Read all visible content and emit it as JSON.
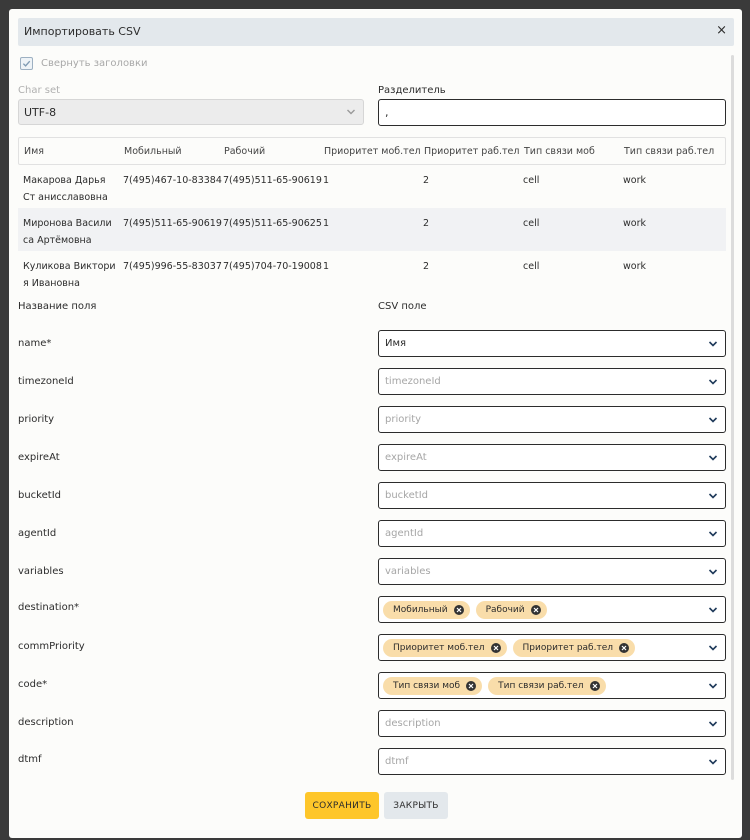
{
  "dialog": {
    "title": "Импортировать CSV",
    "close_glyph": "×"
  },
  "options": {
    "collapse_headers_label": "Свернуть заголовки",
    "collapse_headers_checked": true,
    "charset_label": "Char set",
    "charset_value": "UTF-8",
    "separator_label": "Разделитель",
    "separator_value": ","
  },
  "preview": {
    "columns": [
      "Имя",
      "Мобильный",
      "Рабочий",
      "Приоритет моб.тел",
      "Приоритет раб.тел",
      "Тип связи моб",
      "Тип связи раб.тел"
    ],
    "rows": [
      [
        "Макарова Дарья Ст анисславовна",
        "7(495)467-10-83384",
        "7(495)511-65-90619",
        "1",
        "2",
        "cell",
        "work"
      ],
      [
        "Миронова Васили са Артёмовна",
        "7(495)511-65-90619",
        "7(495)511-65-90625",
        "1",
        "2",
        "cell",
        "work"
      ],
      [
        "Куликова Виктори я Ивановна",
        "7(495)996-55-83037",
        "7(495)704-70-19008",
        "1",
        "2",
        "cell",
        "work"
      ]
    ]
  },
  "mapping": {
    "field_header": "Название поля",
    "csv_header": "CSV поле",
    "fields": [
      {
        "name": "name*",
        "value": "Имя",
        "placeholder": ""
      },
      {
        "name": "timezoneId",
        "value": "",
        "placeholder": "timezoneId"
      },
      {
        "name": "priority",
        "value": "",
        "placeholder": "priority"
      },
      {
        "name": "expireAt",
        "value": "",
        "placeholder": "expireAt"
      },
      {
        "name": "bucketId",
        "value": "",
        "placeholder": "bucketId"
      },
      {
        "name": "agentId",
        "value": "",
        "placeholder": "agentId"
      },
      {
        "name": "variables",
        "value": "",
        "placeholder": "variables"
      },
      {
        "name": "destination*",
        "chips": [
          "Мобильный",
          "Рабочий"
        ]
      },
      {
        "name": "commPriority",
        "chips": [
          "Приоритет моб.тел",
          "Приоритет раб.тел"
        ]
      },
      {
        "name": "code*",
        "chips": [
          "Тип связи моб",
          "Тип связи раб.тел"
        ]
      },
      {
        "name": "description",
        "value": "",
        "placeholder": "description"
      },
      {
        "name": "dtmf",
        "value": "",
        "placeholder": "dtmf"
      }
    ]
  },
  "footer": {
    "save_label": "СОХРАНИТЬ",
    "close_label": "ЗАКРЫТЬ"
  },
  "colors": {
    "accent": "#fec62a",
    "chip": "#f9ddaa",
    "header_bg": "#e3e8ec"
  }
}
